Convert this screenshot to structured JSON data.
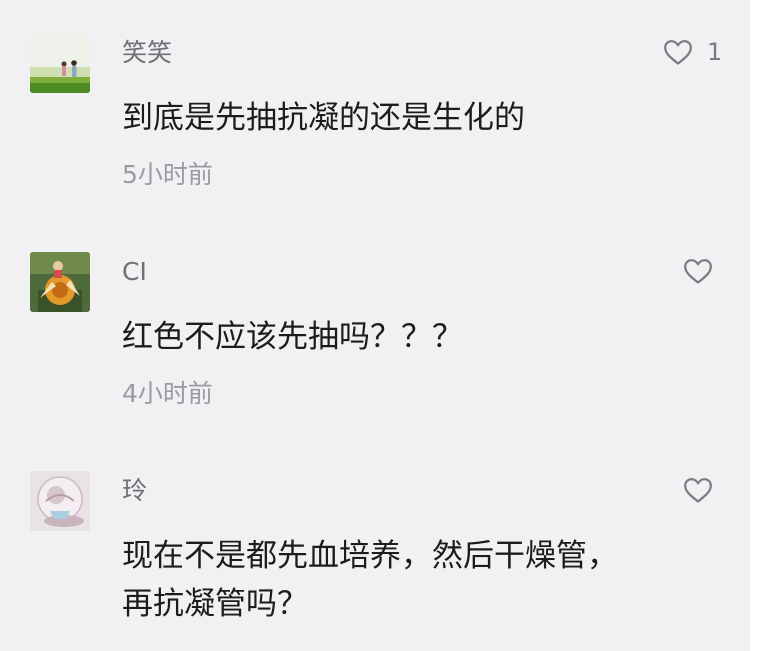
{
  "comments": [
    {
      "username": "笑笑",
      "content": "到底是先抽抗凝的还是生化的",
      "time": "5小时前",
      "likes": "1",
      "avatar_icon": "couple-in-field-avatar"
    },
    {
      "username": "CI",
      "content": "红色不应该先抽吗？？？",
      "time": "4小时前",
      "likes": "",
      "avatar_icon": "orange-figure-avatar"
    },
    {
      "username": "玲",
      "content": "现在不是都先血培养，然后干燥管，\n再抗凝管吗？",
      "time": "",
      "likes": "",
      "avatar_icon": "glass-globe-avatar"
    }
  ],
  "colors": {
    "background": "#f1f1f3",
    "username": "#6f6f74",
    "content": "#1c1c1e",
    "time": "#9a9aa0",
    "icon": "#7a7a80"
  }
}
